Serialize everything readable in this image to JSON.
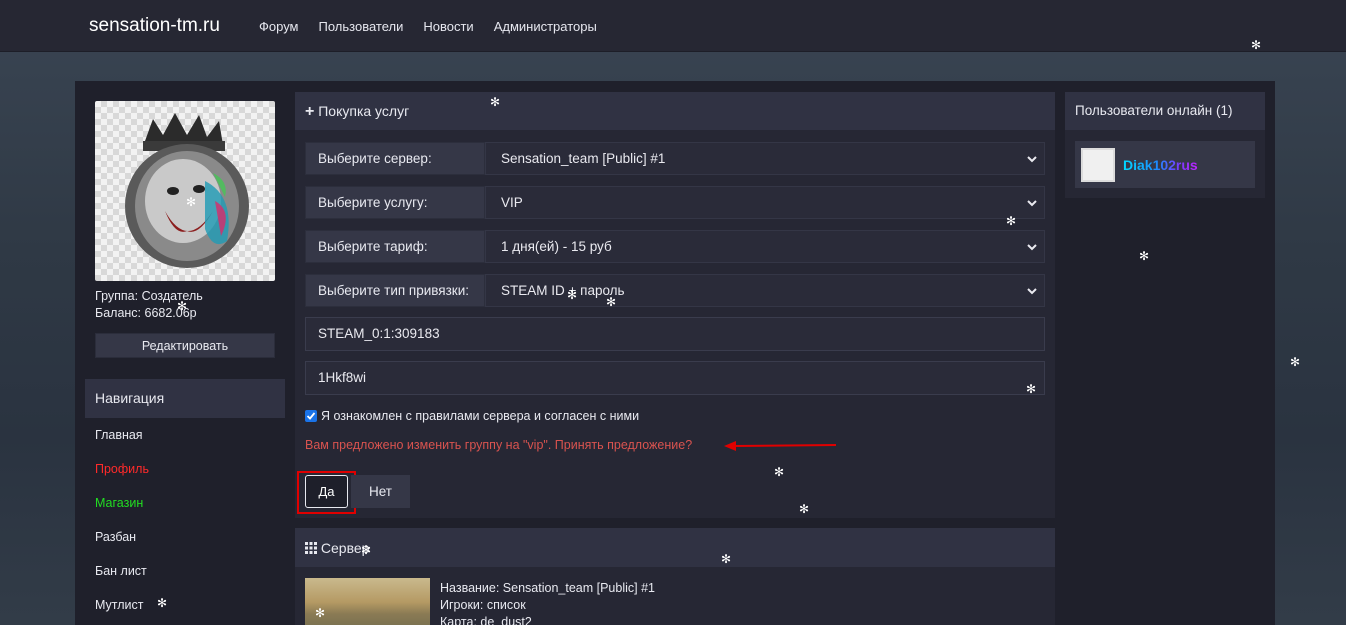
{
  "header": {
    "brand": "sensation-tm.ru",
    "nav": [
      "Форум",
      "Пользователи",
      "Новости",
      "Администраторы"
    ]
  },
  "profile": {
    "group": "Группа: Создатель",
    "balance": "Баланс: 6682.06р",
    "edit_label": "Редактировать"
  },
  "navigation": {
    "title": "Навигация",
    "items": [
      {
        "label": "Главная",
        "color": "#e8e9f0"
      },
      {
        "label": "Профиль",
        "color": "#ff2a2a"
      },
      {
        "label": "Магазин",
        "color": "#22dd22"
      },
      {
        "label": "Разбан",
        "color": "#e8e9f0"
      },
      {
        "label": "Бан лист",
        "color": "#e8e9f0"
      },
      {
        "label": "Мутлист",
        "color": "#e8e9f0"
      }
    ]
  },
  "purchase": {
    "title": "Покупка услуг",
    "fields": [
      {
        "label": "Выберите сервер:",
        "value": "Sensation_team [Public] #1"
      },
      {
        "label": "Выберите услугу:",
        "value": "VIP"
      },
      {
        "label": "Выберите тариф:",
        "value": "1 дня(ей) - 15 руб"
      },
      {
        "label": "Выберите тип привязки:",
        "value": "STEAM ID + пароль"
      }
    ],
    "steam_id": "STEAM_0:1:309183",
    "password": "1Hkf8wi",
    "agree_text": "Я ознакомлен с правилами сервера и согласен с ними",
    "offer_text": "Вам предложено изменить группу на \"vip\". Принять предложение?",
    "yes_label": "Да",
    "no_label": "Нет"
  },
  "servers": {
    "title": "Сервер",
    "name_line": "Название:  Sensation_team [Public] #1",
    "players_line": "Игроки:  список",
    "map_line": "Карта:  de_dust2"
  },
  "online": {
    "title": "Пользователи онлайн (1)",
    "user": "Diak102rus"
  },
  "colors": {
    "accent_red": "#e00000",
    "error_text": "#d9534f"
  }
}
